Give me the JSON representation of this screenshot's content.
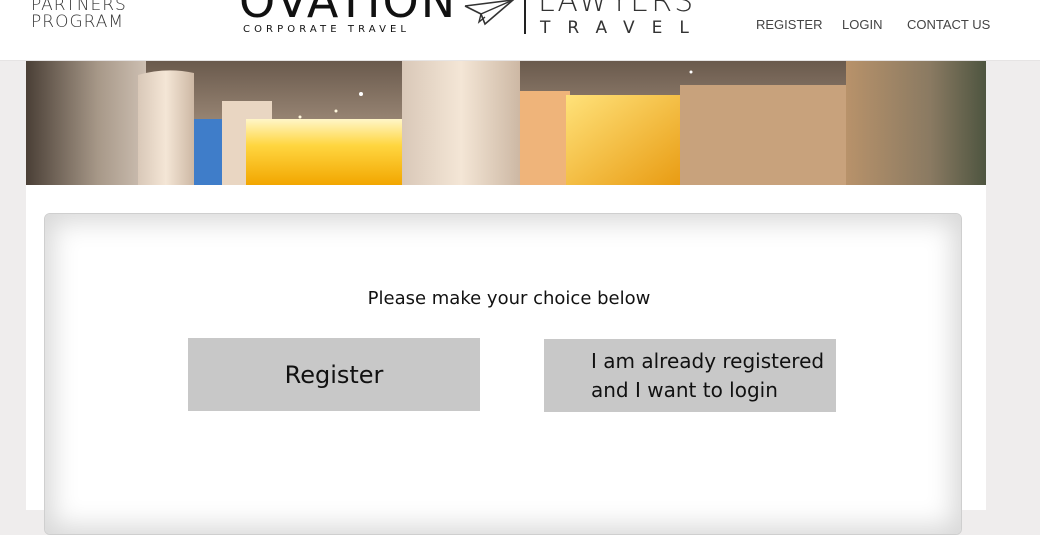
{
  "header": {
    "partners_line1": "PARTNERS",
    "partners_line2": "PROGRAM",
    "ovation_logo": "OVATION",
    "ovation_sub": "CORPORATE TRAVEL",
    "lawyers_logo": "LAWYERS",
    "lawyers_sub": "TRAVEL",
    "nav": {
      "register": "REGISTER",
      "login": "LOGIN",
      "contact": "CONTACT US"
    }
  },
  "main": {
    "heading": "Please make your choice below",
    "register_button": "Register",
    "login_button_line1": "I am already registered",
    "login_button_line2": "and I want to login"
  },
  "colors": {
    "page_background": "#efeded",
    "button_background": "#c8c8c8",
    "hero_accent": "#f5b820"
  }
}
